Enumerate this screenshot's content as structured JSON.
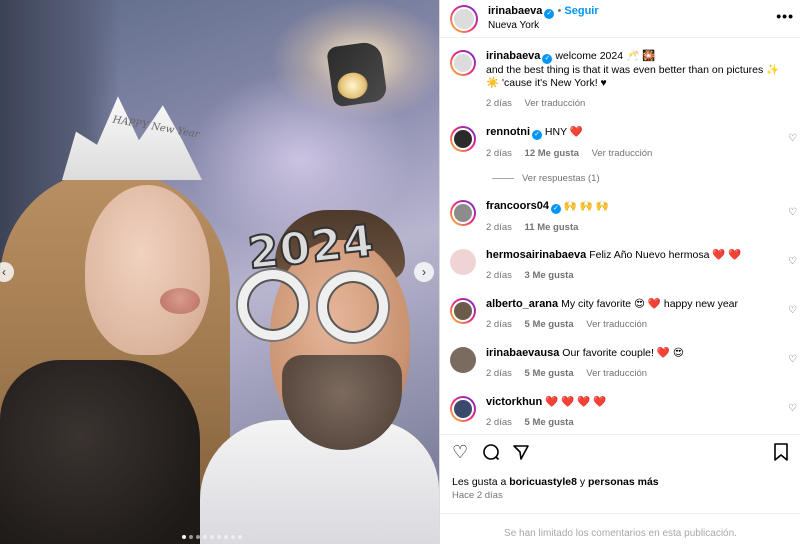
{
  "post": {
    "username": "irinabaeva",
    "follow_label": "Seguir",
    "location": "Nueva York",
    "more_icon": "more-horizontal-icon"
  },
  "photo": {
    "tiara_text": "HAPPY New Year",
    "glasses_text": "2024",
    "carousel_dot_count": 9,
    "carousel_active_index": 0
  },
  "caption": {
    "username": "irinabaeva",
    "line1": "welcome 2024 🥂 🎇",
    "line2": "and the best thing is that it was even better than on pictures ✨",
    "line3": "☀️ 'cause it's New York! ♥",
    "time": "2 días",
    "translate": "Ver traducción"
  },
  "comments": [
    {
      "username": "rennotni",
      "verified": true,
      "text": "HNY ❤️",
      "time": "2 días",
      "likes": "12 Me gusta",
      "translate": "Ver traducción"
    },
    {
      "username": "francoors04",
      "verified": true,
      "text": "🙌 🙌 🙌",
      "time": "2 días",
      "likes": "11 Me gusta",
      "translate": ""
    },
    {
      "username": "hermosairinabaeva",
      "verified": false,
      "text": "Feliz Año Nuevo hermosa ❤️ ❤️",
      "time": "2 días",
      "likes": "3 Me gusta",
      "translate": ""
    },
    {
      "username": "alberto_arana",
      "verified": false,
      "text": "My city favorite 😍 ❤️  happy new year",
      "time": "2 días",
      "likes": "5 Me gusta",
      "translate": "Ver traducción"
    },
    {
      "username": "irinabaevausa",
      "verified": false,
      "text": "Our favorite couple! ❤️ 😍",
      "time": "2 días",
      "likes": "5 Me gusta",
      "translate": "Ver traducción"
    },
    {
      "username": "victorkhun",
      "verified": false,
      "text": "❤️ ❤️ ❤️ ❤️",
      "time": "2 días",
      "likes": "5 Me gusta",
      "translate": ""
    }
  ],
  "replies_label": "Ver respuestas (1)",
  "likes_line": {
    "prefix": "Les gusta a",
    "user": "boricuastyle8",
    "joiner": "y",
    "others": "personas más"
  },
  "ago": "Hace 2 días",
  "footer": "Se han limitado los comentarios en esta publicación.",
  "colors": {
    "accent": "#0095f6",
    "heart": "#ed1c24",
    "meta": "#737373"
  }
}
